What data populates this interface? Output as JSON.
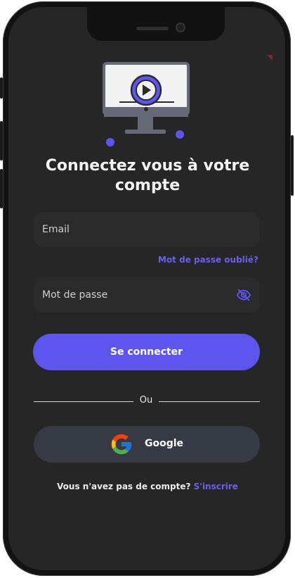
{
  "login": {
    "title_line1": "Connectez vous à votre",
    "title_line2": "compte",
    "email_placeholder": "Email",
    "forgot_password": "Mot de passe oublié?",
    "password_placeholder": "Mot de passe",
    "submit_label": "Se connecter",
    "or_label": "Ou",
    "google_label": "Google",
    "no_account_text": "Vous n'avez pas de compte?",
    "signup_link": "S'inscrire"
  },
  "icons": {
    "illustration": "monitor-play-icon",
    "password_toggle": "eye-off-icon",
    "google": "google-g-icon"
  },
  "colors": {
    "accent": "#5e55ee",
    "link": "#6a5ff2",
    "background": "#262626",
    "input": "#2b2b2b",
    "google_button": "#363a45"
  }
}
